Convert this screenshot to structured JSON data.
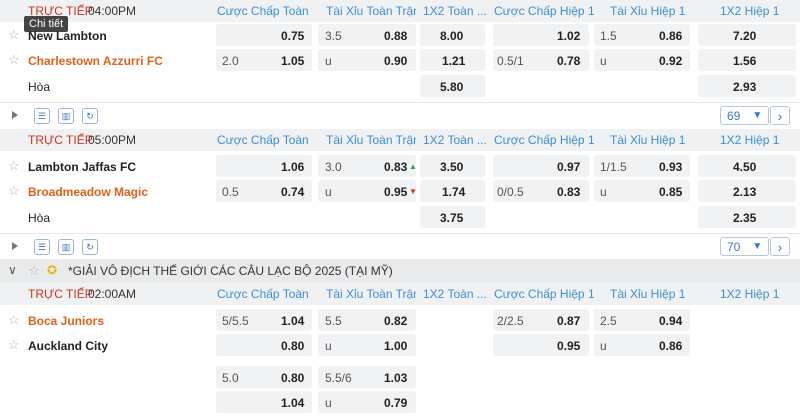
{
  "columns": {
    "handicap_full": "Cược Chấp Toàn ...",
    "ou_full": "Tài Xỉu Toàn Trận",
    "x12_full": "1X2 Toàn ...",
    "handicap_h1": "Cược Chấp Hiệp 1",
    "ou_h1": "Tài Xỉu Hiệp 1",
    "x12_h1": "1X2 Hiệp 1"
  },
  "tooltip": "Chi tiết",
  "live_label": "TRỰC TIẾP",
  "draw_label": "Hòa",
  "match1": {
    "time": "04:00PM",
    "home": "New Lambton",
    "away": "Charlestown Azzurri FC",
    "r1": {
      "hc_line": "",
      "hc_odds": "0.75",
      "ou_line": "3.5",
      "ou_odds": "0.88",
      "x12": "8.00",
      "h1hc_line": "",
      "h1hc_odds": "1.02",
      "h1ou_line": "1.5",
      "h1ou_odds": "0.86",
      "h1x12": "7.20"
    },
    "r2": {
      "hc_line": "2.0",
      "hc_odds": "1.05",
      "ou_line": "u",
      "ou_odds": "0.90",
      "x12": "1.21",
      "h1hc_line": "0.5/1",
      "h1hc_odds": "0.78",
      "h1ou_line": "u",
      "h1ou_odds": "0.92",
      "h1x12": "1.56"
    },
    "r3": {
      "x12": "5.80",
      "h1x12": "2.93"
    },
    "count": "69"
  },
  "match2": {
    "time": "05:00PM",
    "home": "Lambton Jaffas FC",
    "away": "Broadmeadow Magic",
    "r1": {
      "hc_line": "",
      "hc_odds": "1.06",
      "ou_line": "3.0",
      "ou_odds": "0.83",
      "x12": "3.50",
      "h1hc_line": "",
      "h1hc_odds": "0.97",
      "h1ou_line": "1/1.5",
      "h1ou_odds": "0.93",
      "h1x12": "4.50"
    },
    "r2": {
      "hc_line": "0.5",
      "hc_odds": "0.74",
      "ou_line": "u",
      "ou_odds": "0.95",
      "x12": "1.74",
      "h1hc_line": "0/0.5",
      "h1hc_odds": "0.83",
      "h1ou_line": "u",
      "h1ou_odds": "0.85",
      "h1x12": "2.13"
    },
    "r3": {
      "x12": "3.75",
      "h1x12": "2.35"
    },
    "count": "70"
  },
  "league": {
    "title": "*GIẢI VÔ ĐỊCH THẾ GIỚI CÁC CÂU LẠC BỘ 2025 (TẠI MỸ)"
  },
  "match3": {
    "time": "02:00AM",
    "home": "Boca Juniors",
    "away": "Auckland City",
    "r1": {
      "hc_line": "5/5.5",
      "hc_odds": "1.04",
      "ou_line": "5.5",
      "ou_odds": "0.82",
      "h1hc_line": "2/2.5",
      "h1hc_odds": "0.87",
      "h1ou_line": "2.5",
      "h1ou_odds": "0.94"
    },
    "r2": {
      "hc_odds": "0.80",
      "ou_line": "u",
      "ou_odds": "1.00",
      "h1hc_odds": "0.95",
      "h1ou_line": "u",
      "h1ou_odds": "0.86"
    },
    "r3": {
      "hc_line": "5.0",
      "hc_odds": "0.80",
      "ou_line": "5.5/6",
      "ou_odds": "1.03"
    },
    "r4": {
      "hc_odds": "1.04",
      "ou_line": "u",
      "ou_odds": "0.79"
    }
  },
  "colors": {
    "live": "#d0331e",
    "header_link": "#3b8fd6",
    "team_highlight": "#e2611a",
    "odds_up": "#2aa24a",
    "odds_down": "#d0331e"
  }
}
